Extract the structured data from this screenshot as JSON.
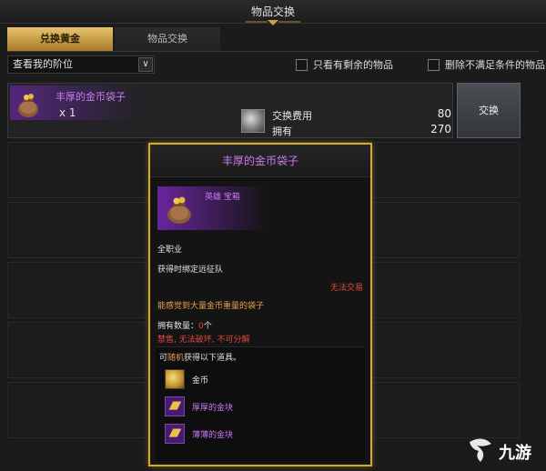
{
  "window": {
    "title": "物品交换"
  },
  "tabs": [
    {
      "label": "兑换黄金",
      "active": true
    },
    {
      "label": "物品交换",
      "active": false
    }
  ],
  "filters": {
    "tier_select": "查看我的阶位",
    "only_remaining": "只看有剩余的物品",
    "hide_unmet": "删除不满足条件的物品"
  },
  "list": {
    "item": {
      "name": "丰厚的金币袋子",
      "count": "x 1"
    },
    "cost": {
      "label": "交换费用",
      "value": "80",
      "owned_label": "拥有",
      "owned_value": "270"
    },
    "exchange_button": "交换"
  },
  "tooltip": {
    "title": "丰厚的金币袋子",
    "rarity": "英雄 宝箱",
    "class": "全职业",
    "bind": "获得时绑定远征队",
    "trade": "无法交易",
    "description": "能感觉到大量金币重量的袋子",
    "owned_label": "拥有数量：",
    "owned_value": "0",
    "owned_unit": "个",
    "restrictions": "禁售, 无法破坏, 不可分解",
    "random_prefix": "可",
    "random_word": "随机",
    "random_suffix": "获得以下道具。",
    "rewards": [
      {
        "name": "金币",
        "icon": "coin-icon",
        "color": "white"
      },
      {
        "name": "厚厚的金块",
        "icon": "gold-bar-icon",
        "color": "purple"
      },
      {
        "name": "薄薄的金块",
        "icon": "gold-bar-icon",
        "color": "purple"
      }
    ]
  },
  "watermark": {
    "text": "九游"
  },
  "colors": {
    "accent_gold": "#d7aa2a",
    "hero_purple": "#c97bf0",
    "warning_red": "#e0493a"
  }
}
